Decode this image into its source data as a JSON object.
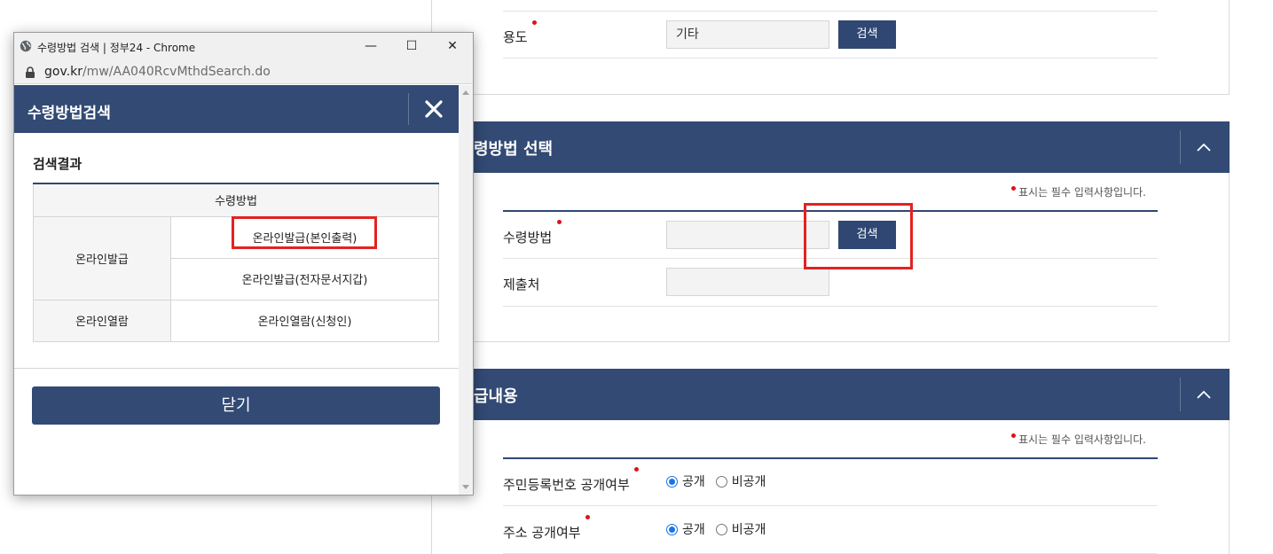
{
  "popup": {
    "window_title": "수령방법 검색 | 정부24 - Chrome",
    "window_controls": {
      "minimize": "—",
      "maximize": "☐",
      "close": "✕"
    },
    "url_host": "gov.kr",
    "url_path": "/mw/AA040RcvMthdSearch.do",
    "header_title": "수령방법검색",
    "result_title": "검색결과",
    "table_header": "수령방법",
    "rows": [
      {
        "group": "온라인발급",
        "methods": [
          "온라인발급(본인출력)",
          "온라인발급(전자문서지갑)"
        ]
      },
      {
        "group": "온라인열람",
        "methods": [
          "온라인열람(신청인)"
        ]
      }
    ],
    "close_button": "닫기"
  },
  "form": {
    "purpose": {
      "label": "용도",
      "value": "기타",
      "button": "검색"
    },
    "section_receive": {
      "title": "령방법 선택",
      "required_note": "표시는 필수 입력사항입니다.",
      "method": {
        "label": "수령방법",
        "value": "",
        "button": "검색"
      },
      "submit_to": {
        "label": "제출처",
        "value": ""
      }
    },
    "section_issue": {
      "title": "급내용",
      "required_note": "표시는 필수 입력사항입니다.",
      "rrn_disclosure": {
        "label": "주민등록번호 공개여부",
        "options": [
          "공개",
          "비공개"
        ],
        "selected": "공개"
      },
      "address_disclosure": {
        "label": "주소 공개여부",
        "options": [
          "공개",
          "비공개"
        ],
        "selected": "공개"
      }
    }
  },
  "colors": {
    "navy": "#324a74",
    "button": "#2f4772",
    "required": "#d9141b",
    "highlight": "#e32222",
    "radio": "#1a73e8"
  }
}
